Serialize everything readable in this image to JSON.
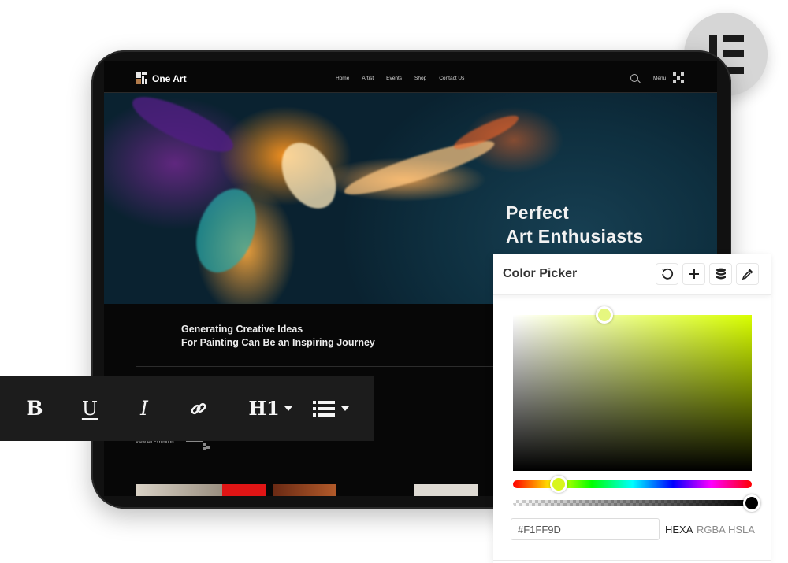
{
  "site": {
    "logo_text": "One Art",
    "nav": [
      "Home",
      "Artist",
      "Events",
      "Shop",
      "Contact Us"
    ],
    "menu_label": "Menu",
    "hero_title_line1": "Perfect",
    "hero_title_line2": "Art Enthusiasts",
    "tagline_line1": "Generating Creative Ideas",
    "tagline_line2": "For Painting Can Be an Inspiring Journey",
    "view_all": "View All Exhibition"
  },
  "toolbar": {
    "bold_label": "B",
    "underline_label": "U",
    "italic_label": "I",
    "heading_label": "H1",
    "icons": [
      "link-icon",
      "list-icon",
      "chevron-down-icon"
    ]
  },
  "color_picker": {
    "title": "Color Picker",
    "tools": [
      "reset-icon",
      "add-icon",
      "database-icon",
      "eyedropper-icon"
    ],
    "hex_value": "#F1FF9D",
    "modes": [
      "HEXA",
      "RGBA",
      "HSLA"
    ],
    "active_mode": "HEXA",
    "hue_color": "#d9ff00",
    "selected_color": "#F1FF9D"
  },
  "badge": {
    "icon": "elementor-logo-icon"
  }
}
